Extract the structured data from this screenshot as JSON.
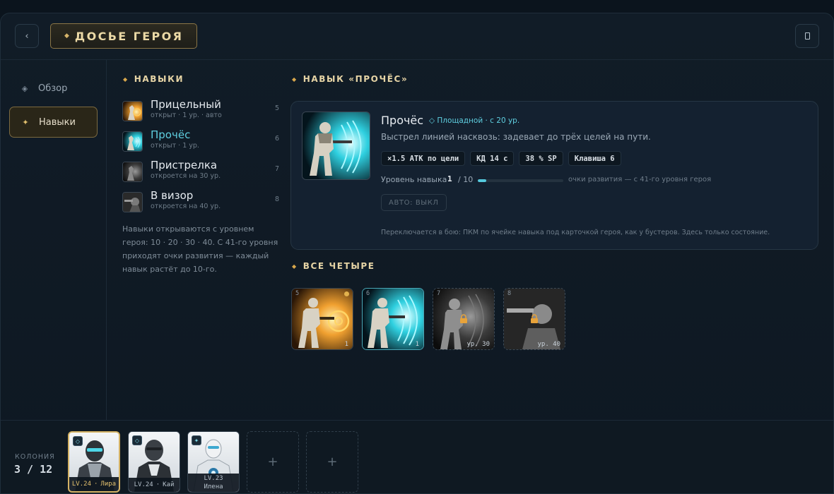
{
  "header": {
    "title": "ДОСЬЕ ГЕРОЯ",
    "back_icon": "‹"
  },
  "sidebar": {
    "items": [
      {
        "label": "Обзор",
        "icon": "◈"
      },
      {
        "label": "Навыки",
        "icon": "✦"
      }
    ]
  },
  "skills_section": {
    "title": "НАВЫКИ",
    "items": [
      {
        "name": "Прицельный",
        "status": "открыт · 1 ур. · авто",
        "num": "5"
      },
      {
        "name": "Прочёс",
        "status": "открыт · 1 ур.",
        "num": "6"
      },
      {
        "name": "Пристрелка",
        "status": "откроется на 30 ур.",
        "num": "7"
      },
      {
        "name": "В визор",
        "status": "откроется на 40 ур.",
        "num": "8"
      }
    ],
    "note": "Навыки открываются с уровнем героя: 10 · 20 · 30 · 40. С 41-го уровня приходят очки развития — каждый навык растёт до 10-го."
  },
  "detail": {
    "section_title": "НАВЫК «ПРОЧЁС»",
    "name": "Прочёс",
    "tag": "◇ Площадной · с 20 ур.",
    "description": "Выстрел линией насквозь: задевает до трёх целей на пути.",
    "chips": [
      "×1.5 АТК по цели",
      "КД 14 с",
      "38 % SP",
      "Клавиша 6"
    ],
    "level_label": "Уровень навыка",
    "level_current": "1",
    "level_max": "/ 10",
    "level_fraction": 0.1,
    "level_hint": "очки развития — с 41-го уровня героя",
    "auto_label": "АВТО: ВЫКЛ",
    "footer": "Переключается в бою: ПКМ по ячейке навыка под карточкой героя, как у бустеров. Здесь только состояние."
  },
  "all_four": {
    "title": "ВСЕ ЧЕТЫРЕ",
    "tiles": [
      {
        "num": "5",
        "level": "1"
      },
      {
        "num": "6",
        "level": "1"
      },
      {
        "num": "7",
        "level": "ур. 30"
      },
      {
        "num": "8",
        "level": "ур. 40"
      }
    ]
  },
  "colony": {
    "label": "КОЛОНИЯ",
    "count": "3 / 12",
    "heroes": [
      {
        "level": "LV.24",
        "name": "Лира"
      },
      {
        "level": "LV.24",
        "name": "Кай"
      },
      {
        "level": "LV.23",
        "name": "Илена"
      }
    ],
    "empty_icon": "+"
  },
  "colors": {
    "accent_gold": "#d4b264",
    "accent_cyan": "#5fcfe0",
    "background": "#0e1822"
  }
}
